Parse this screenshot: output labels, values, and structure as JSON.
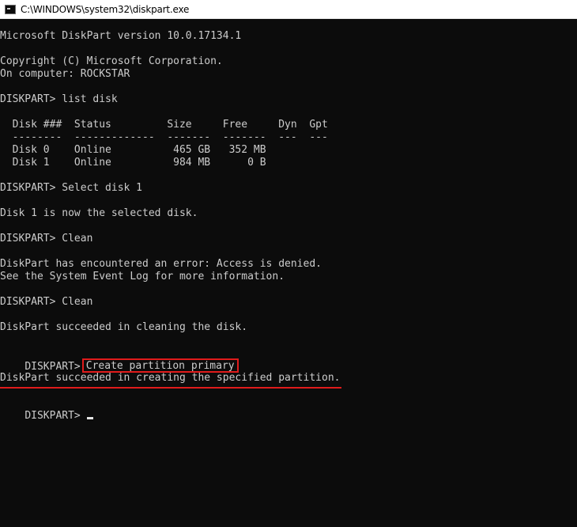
{
  "window": {
    "title": "C:\\WINDOWS\\system32\\diskpart.exe",
    "icon": "console-icon"
  },
  "console": {
    "lines": [
      "Microsoft DiskPart version 10.0.17134.1",
      "",
      "Copyright (C) Microsoft Corporation.",
      "On computer: ROCKSTAR",
      "",
      "DISKPART> list disk",
      "",
      "  Disk ###  Status         Size     Free     Dyn  Gpt",
      "  --------  -------------  -------  -------  ---  ---",
      "  Disk 0    Online          465 GB   352 MB",
      "  Disk 1    Online          984 MB      0 B",
      "",
      "DISKPART> Select disk 1",
      "",
      "Disk 1 is now the selected disk.",
      "",
      "DISKPART> Clean",
      "",
      "DiskPart has encountered an error: Access is denied.",
      "See the System Event Log for more information.",
      "",
      "DISKPART> Clean",
      "",
      "DiskPart succeeded in cleaning the disk.",
      ""
    ],
    "highlight_prompt": "DISKPART>",
    "highlight_command": "Create partition primary",
    "success_line": "DiskPart succeeded in creating the specified partition.",
    "final_prompt": "DISKPART>"
  },
  "annotation_colors": {
    "box": "#e01b1b",
    "underline": "#e01b1b"
  }
}
